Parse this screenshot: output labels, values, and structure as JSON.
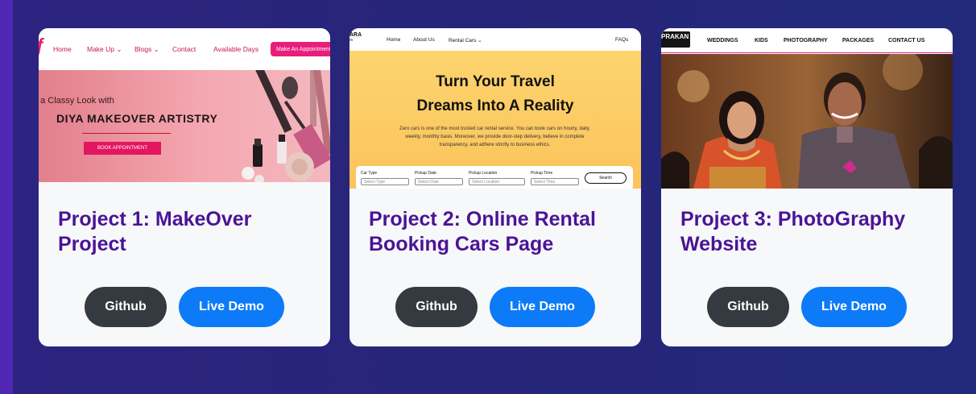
{
  "projects": [
    {
      "title": "Project 1: MakeOver Project",
      "github_label": "Github",
      "demo_label": "Live Demo",
      "thumbnail": {
        "nav": [
          "Home",
          "Make Up",
          "Blogs",
          "Contact",
          "Available Days"
        ],
        "cta": "Make An Appointment",
        "tagline": "t a Classy Look with",
        "heading": "DIYA MAKEOVER ARTISTRY",
        "button": "BOOK APPOINTMENT"
      }
    },
    {
      "title": "Project 2: Online Rental Booking Cars Page",
      "github_label": "Github",
      "demo_label": "Live Demo",
      "thumbnail": {
        "logo_top": "ARA",
        "logo_bottom": "rs",
        "nav": [
          "Home",
          "About Us",
          "Rental Cars"
        ],
        "nav_right": "FAQs",
        "heading_line1": "Turn Your Travel",
        "heading_line2": "Dreams Into A Reality",
        "paragraph": "Zero cars is one of the most trusted car rental service. You can book cars on hourly, daily, weekly, monthly basis. Moreover, we provide door-step delivery, believe in complete transparency, and adhere strictly to business ethics.",
        "fields": [
          "Car Type",
          "Pickup Date",
          "Pickup Location",
          "Pickup Time"
        ],
        "placeholders": [
          "Select Type",
          "Select Date",
          "Select Location",
          "Select Time"
        ],
        "search": "Search"
      }
    },
    {
      "title": "Project 3: PhotoGraphy Website",
      "github_label": "Github",
      "demo_label": "Live Demo",
      "thumbnail": {
        "logo": "PRAKAN",
        "nav": [
          "WEDDINGS",
          "KIDS",
          "PHOTOGRAPHY",
          "PACKAGES",
          "CONTACT US"
        ]
      }
    }
  ]
}
